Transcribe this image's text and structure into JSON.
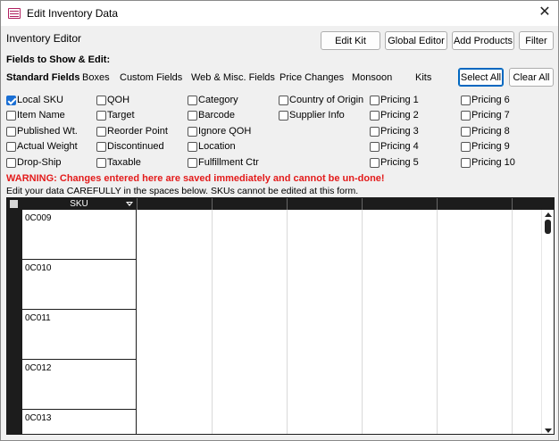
{
  "window": {
    "title": "Edit Inventory Data",
    "close_symbol": "✕"
  },
  "header": {
    "editor_title": "Inventory Editor",
    "buttons": {
      "edit_kit": "Edit Kit",
      "global_editor": "Global Editor",
      "add_products": "Add Products",
      "filter": "Filter"
    }
  },
  "fields": {
    "section_label": "Fields to Show & Edit:",
    "tabs": [
      "Standard Fields",
      "Boxes",
      "Custom Fields",
      "Web & Misc. Fields",
      "Price Changes",
      "Monsoon",
      "Kits"
    ],
    "select_all": "Select All",
    "clear_all": "Clear All",
    "checkboxes": [
      [
        "Local SKU",
        "Item Name",
        "Published Wt.",
        "Actual Weight",
        "Drop-Ship"
      ],
      [
        "QOH",
        "Target",
        "Reorder Point",
        "Discontinued",
        "Taxable"
      ],
      [
        "Category",
        "Barcode",
        "Ignore QOH",
        "Location",
        "Fulfillment Ctr"
      ],
      [
        "Country of Origin",
        "Supplier Info"
      ],
      [
        "Pricing 1",
        "Pricing 2",
        "Pricing 3",
        "Pricing 4",
        "Pricing 5"
      ],
      [
        "Pricing 6",
        "Pricing 7",
        "Pricing 8",
        "Pricing 9",
        "Pricing 10"
      ]
    ],
    "checked": [
      "Local SKU"
    ]
  },
  "messages": {
    "warning": "WARNING: Changes entered here are saved immediately and cannot be un-done!",
    "instructions": "Edit your data CAREFULLY in the spaces below. SKUs cannot be edited at this form."
  },
  "grid": {
    "sku_header": "SKU",
    "rows": [
      "0C009",
      "0C010",
      "0C011",
      "0C012",
      "0C013"
    ]
  },
  "colors": {
    "warning": "#e31b1b",
    "grid_header": "#1c1c1c",
    "checkbox_checked": "#1a6fd4",
    "focus_border": "#0067c0"
  }
}
